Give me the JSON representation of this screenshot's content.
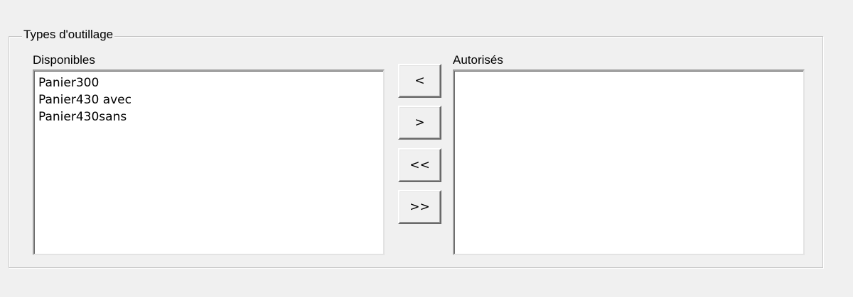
{
  "group": {
    "title": "Types d'outillage"
  },
  "available": {
    "label": "Disponibles",
    "items": [
      "Panier300",
      "Panier430 avec",
      "Panier430sans"
    ]
  },
  "allowed": {
    "label": "Autorisés",
    "items": []
  },
  "buttons": {
    "remove": "<",
    "add": ">",
    "remove_all": "<<",
    "add_all": ">>"
  }
}
